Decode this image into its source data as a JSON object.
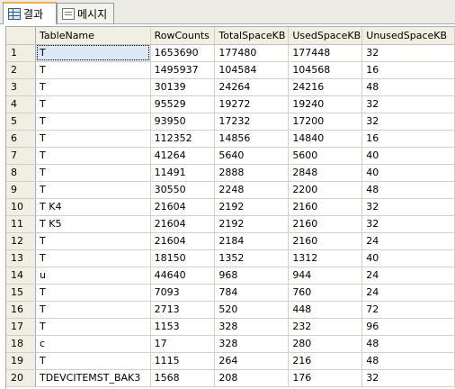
{
  "tabs": [
    {
      "label": "결과",
      "icon": "grid-icon",
      "active": true
    },
    {
      "label": "메시지",
      "icon": "message-icon",
      "active": false
    }
  ],
  "grid": {
    "columns": [
      "TableName",
      "RowCounts",
      "TotalSpaceKB",
      "UsedSpaceKB",
      "UnusedSpaceKB"
    ],
    "rows": [
      {
        "n": "1",
        "name": "T",
        "rows": "1653690",
        "total": "177480",
        "used": "177448",
        "unused": "32"
      },
      {
        "n": "2",
        "name": "T",
        "rows": "1495937",
        "total": "104584",
        "used": "104568",
        "unused": "16"
      },
      {
        "n": "3",
        "name": "T",
        "rows": "30139",
        "total": "24264",
        "used": "24216",
        "unused": "48"
      },
      {
        "n": "4",
        "name": "T",
        "rows": "95529",
        "total": "19272",
        "used": "19240",
        "unused": "32"
      },
      {
        "n": "5",
        "name": "T",
        "rows": "93950",
        "total": "17232",
        "used": "17200",
        "unused": "32"
      },
      {
        "n": "6",
        "name": "T",
        "rows": "112352",
        "total": "14856",
        "used": "14840",
        "unused": "16"
      },
      {
        "n": "7",
        "name": "T",
        "rows": "41264",
        "total": "5640",
        "used": "5600",
        "unused": "40"
      },
      {
        "n": "8",
        "name": "T",
        "rows": "11491",
        "total": "2888",
        "used": "2848",
        "unused": "40"
      },
      {
        "n": "9",
        "name": "T",
        "rows": "30550",
        "total": "2248",
        "used": "2200",
        "unused": "48"
      },
      {
        "n": "10",
        "name": "T                     K4",
        "rows": "21604",
        "total": "2192",
        "used": "2160",
        "unused": "32"
      },
      {
        "n": "11",
        "name": "T                     K5",
        "rows": "21604",
        "total": "2192",
        "used": "2160",
        "unused": "32"
      },
      {
        "n": "12",
        "name": "T",
        "rows": "21604",
        "total": "2184",
        "used": "2160",
        "unused": "24"
      },
      {
        "n": "13",
        "name": "T",
        "rows": "18150",
        "total": "1352",
        "used": "1312",
        "unused": "40"
      },
      {
        "n": "14",
        "name": "u",
        "rows": "44640",
        "total": "968",
        "used": "944",
        "unused": "24"
      },
      {
        "n": "15",
        "name": "T",
        "rows": "7093",
        "total": "784",
        "used": "760",
        "unused": "24"
      },
      {
        "n": "16",
        "name": "T",
        "rows": "2713",
        "total": "520",
        "used": "448",
        "unused": "72"
      },
      {
        "n": "17",
        "name": "T",
        "rows": "1153",
        "total": "328",
        "used": "232",
        "unused": "96"
      },
      {
        "n": "18",
        "name": "c",
        "rows": "17",
        "total": "328",
        "used": "280",
        "unused": "48"
      },
      {
        "n": "19",
        "name": "T",
        "rows": "1115",
        "total": "264",
        "used": "216",
        "unused": "48"
      },
      {
        "n": "20",
        "name": "TDEVCITEMST_BAK3",
        "rows": "1568",
        "total": "208",
        "used": "176",
        "unused": "32"
      }
    ]
  }
}
